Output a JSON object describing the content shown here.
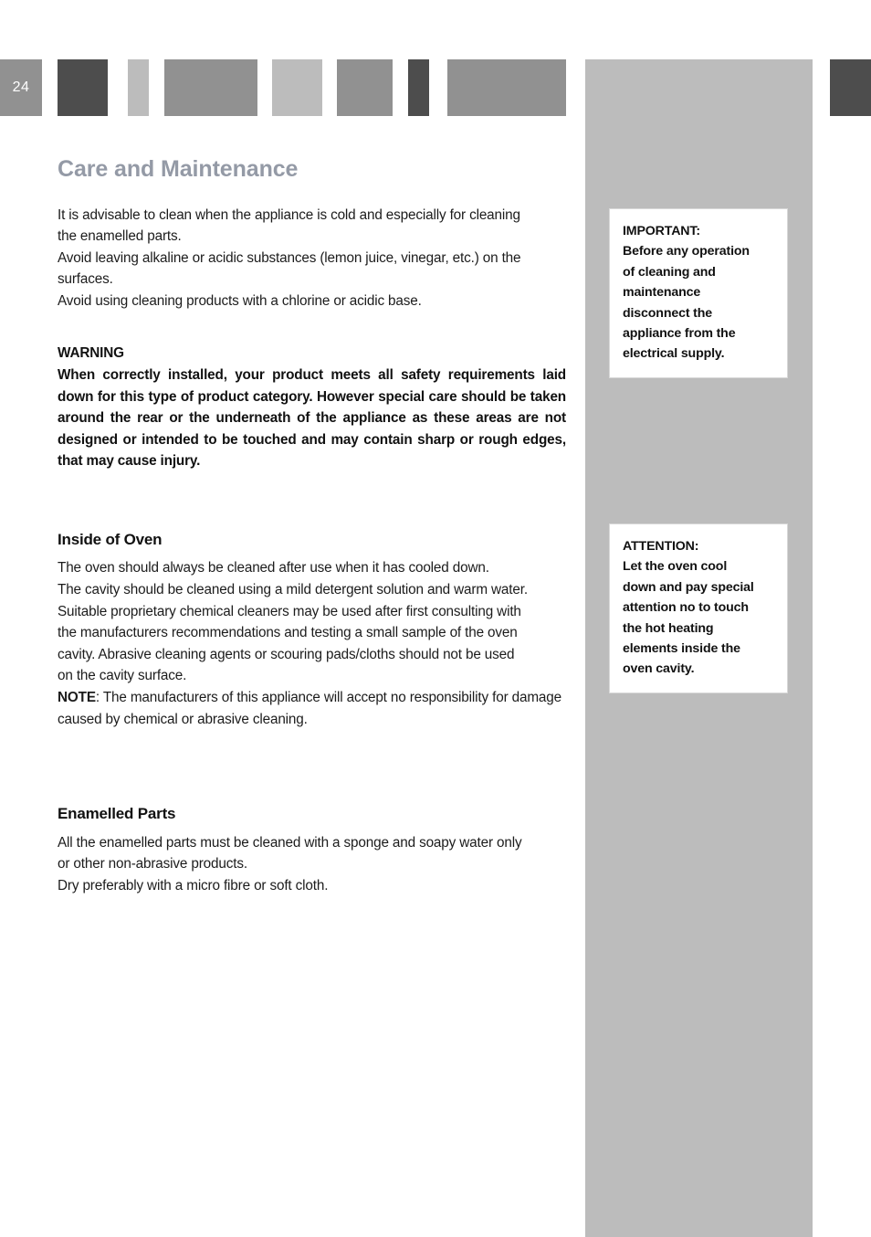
{
  "page": {
    "number": "24"
  },
  "topbar": {
    "bars": [
      {
        "name": "bar-dark-1",
        "color": "#4d4d4d"
      },
      {
        "name": "bar-light-1",
        "color": "#bcbcbc"
      },
      {
        "name": "bar-medium-1",
        "color": "#919191"
      },
      {
        "name": "bar-light-2",
        "color": "#bcbcbc"
      },
      {
        "name": "bar-medium-2",
        "color": "#919191"
      },
      {
        "name": "bar-dark-2",
        "color": "#4d4d4d"
      },
      {
        "name": "bar-medium-3",
        "color": "#919191"
      },
      {
        "name": "bar-light-3",
        "color": "#bcbcbc"
      },
      {
        "name": "bar-dark-3",
        "color": "#4d4d4d"
      }
    ]
  },
  "colors": {
    "title": "#949aa6",
    "sidebar": "#bcbcbc",
    "dark_bar": "#4d4d4d",
    "medium_bar": "#919191",
    "body_text": "#1c1c1c"
  },
  "main": {
    "title": "Care and Maintenance",
    "intro": {
      "line1": "It is advisable to clean when the appliance is cold and especially for cleaning",
      "line2": "the enamelled parts.",
      "line3": "Avoid leaving alkaline or acidic substances (lemon juice, vinegar, etc.) on the",
      "line4": "surfaces.",
      "line5": "Avoid using cleaning products with a chlorine or acidic base."
    },
    "warning": {
      "title": "WARNING",
      "body": "When correctly installed, your product meets all safety requirements laid down for this type of product category. However special care should be taken around the rear or the underneath of  the appliance as these areas are not designed or intended to be touched and may contain sharp or rough edges, that may cause injury."
    },
    "inside_of_oven": {
      "heading": "Inside of Oven",
      "line1": "The oven should always be cleaned after use when it has cooled down.",
      "line2": "The cavity should be cleaned using a mild detergent solution  and warm water.",
      "line3": "Suitable proprietary chemical cleaners may be used after first consulting with",
      "line4": "the manufacturers recommendations and testing a small sample of the oven",
      "line5": "cavity. Abrasive cleaning agents or scouring pads/cloths should not be used",
      "line6": "on the cavity surface.",
      "note_label": "NOTE",
      "note_text": ": The manufacturers of this appliance will accept no responsibility for damage caused by chemical or abrasive cleaning."
    },
    "enamelled_parts": {
      "heading": "Enamelled Parts",
      "line1": "All the enamelled parts must be cleaned with a sponge and soapy water only",
      "line2": "or other non-abrasive products.",
      "line3": "Dry preferably with a micro fibre or soft cloth."
    }
  },
  "callouts": {
    "important": {
      "line1": "IMPORTANT:",
      "line2": "Before any operation",
      "line3": "of cleaning and",
      "line4": "maintenance",
      "line5": "disconnect the",
      "line6": "appliance from the",
      "line7": "electrical supply."
    },
    "attention": {
      "line1": "ATTENTION:",
      "line2": "Let the oven cool",
      "line3": "down and pay special",
      "line4": "attention no to touch",
      "line5": "the hot heating",
      "line6": "elements inside the",
      "line7": "oven cavity."
    }
  }
}
